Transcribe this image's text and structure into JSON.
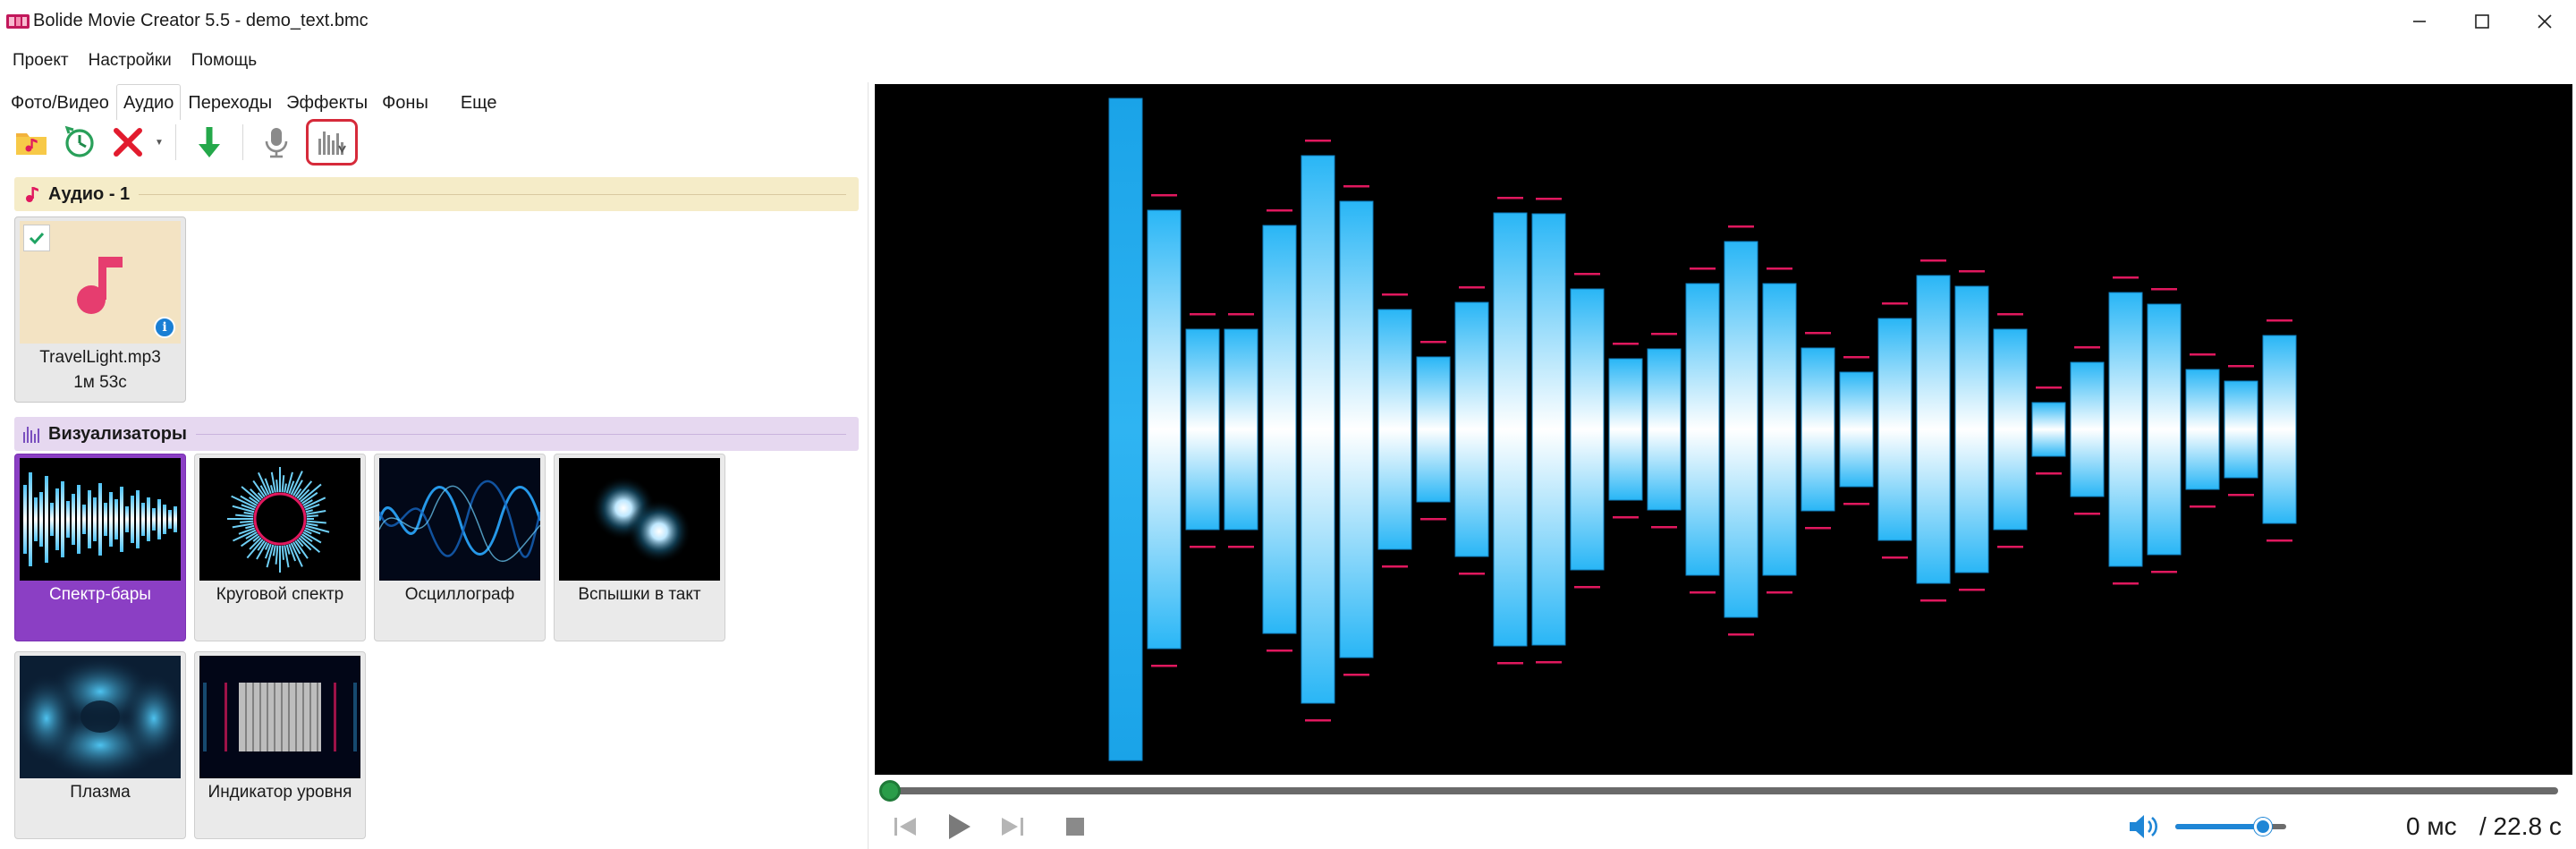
{
  "window": {
    "title": "Bolide Movie Creator 5.5 - demo_text.bmc",
    "controls": [
      "minimize",
      "maximize",
      "close"
    ]
  },
  "menu": [
    "Проект",
    "Настройки",
    "Помощь"
  ],
  "tabs": [
    {
      "label": "Фото/Видео",
      "active": false
    },
    {
      "label": "Аудио",
      "active": true
    },
    {
      "label": "Переходы",
      "active": false
    },
    {
      "label": "Эффекты",
      "active": false
    },
    {
      "label": "Фоны",
      "active": false
    },
    {
      "label": "Еще",
      "active": false
    }
  ],
  "toolbar": {
    "buttons": [
      "add-audio-folder-icon",
      "history-clock-icon",
      "delete-x-icon",
      "download-arrow-icon",
      "microphone-icon",
      "spectrum-bars-icon"
    ],
    "highlighted": "spectrum-bars-icon"
  },
  "audio_group": {
    "title": "Аудио - 1",
    "items": [
      {
        "name": "TravelLight.mp3",
        "duration": "1м 53с",
        "checked": true
      }
    ]
  },
  "visualizers_group": {
    "title": "Визуализаторы",
    "items": [
      {
        "label": "Спектр-бары",
        "selected": true
      },
      {
        "label": "Круговой спектр",
        "selected": false
      },
      {
        "label": "Осциллограф",
        "selected": false
      },
      {
        "label": "Вспышки в такт",
        "selected": false
      },
      {
        "label": "Плазма",
        "selected": false
      },
      {
        "label": "Индикатор уровня",
        "selected": false
      }
    ]
  },
  "player": {
    "current_time": "0 мс",
    "total_time": "/ 22.8 с",
    "volume": 0.8,
    "position": 0
  },
  "colors": {
    "accent_purple": "#8b3fc4",
    "highlight_red": "#d62a3a",
    "seek_green": "#2a9d49",
    "volume_blue": "#1f86d6",
    "bar_blue": "#29b6f6",
    "peak_pink": "#e0185e"
  }
}
